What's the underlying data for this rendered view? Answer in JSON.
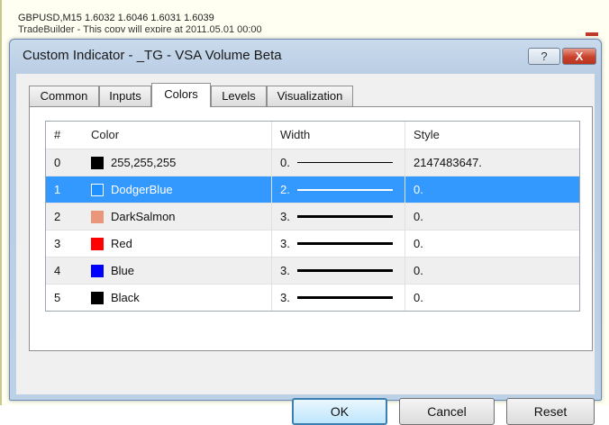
{
  "chart_header": {
    "symbol_line": "GBPUSD,M15  1.6032 1.6046 1.6031 1.6039",
    "license_line": "TradeBuilder - This copy will expire at 2011.05.01 00:00"
  },
  "dialog": {
    "title": "Custom Indicator - _TG - VSA Volume Beta",
    "help_label": "?",
    "close_label": "X"
  },
  "tabs": [
    {
      "label": "Common",
      "active": false
    },
    {
      "label": "Inputs",
      "active": false
    },
    {
      "label": "Colors",
      "active": true
    },
    {
      "label": "Levels",
      "active": false
    },
    {
      "label": "Visualization",
      "active": false
    }
  ],
  "table": {
    "headers": {
      "index": "#",
      "color": "Color",
      "width": "Width",
      "style": "Style"
    },
    "rows": [
      {
        "index": "0",
        "color_name": "255,255,255",
        "swatch": "#000000",
        "width": "0.",
        "line_thickness": 1,
        "style": "2147483647.",
        "selected": false
      },
      {
        "index": "1",
        "color_name": "DodgerBlue",
        "swatch": "#1e90ff",
        "width": "2.",
        "line_thickness": 2,
        "style": "0.",
        "selected": true
      },
      {
        "index": "2",
        "color_name": "DarkSalmon",
        "swatch": "#e9967a",
        "width": "3.",
        "line_thickness": 3,
        "style": "0.",
        "selected": false
      },
      {
        "index": "3",
        "color_name": "Red",
        "swatch": "#ff0000",
        "width": "3.",
        "line_thickness": 3,
        "style": "0.",
        "selected": false
      },
      {
        "index": "4",
        "color_name": "Blue",
        "swatch": "#0000ff",
        "width": "3.",
        "line_thickness": 3,
        "style": "0.",
        "selected": false
      },
      {
        "index": "5",
        "color_name": "Black",
        "swatch": "#000000",
        "width": "3.",
        "line_thickness": 3,
        "style": "0.",
        "selected": false
      }
    ]
  },
  "buttons": {
    "ok": "OK",
    "cancel": "Cancel",
    "reset": "Reset"
  },
  "colors": {
    "selection": "#3399ff",
    "dialog_frame": "#bcd0e6",
    "close_red": "#c9412b"
  }
}
